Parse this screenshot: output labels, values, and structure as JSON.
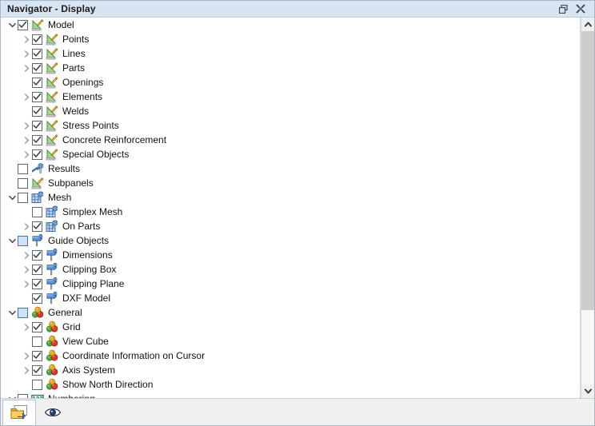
{
  "window": {
    "title": "Navigator - Display",
    "controls": [
      {
        "name": "restore-button",
        "icon": "restore-icon"
      },
      {
        "name": "close-button",
        "icon": "close-icon"
      }
    ]
  },
  "tree": {
    "rows": [
      {
        "label": "Model",
        "depth": 0,
        "twisty": "down",
        "check": "checked",
        "icon": "model-icon"
      },
      {
        "label": "Points",
        "depth": 1,
        "twisty": "right",
        "check": "checked",
        "icon": "model-icon"
      },
      {
        "label": "Lines",
        "depth": 1,
        "twisty": "right",
        "check": "checked",
        "icon": "model-icon"
      },
      {
        "label": "Parts",
        "depth": 1,
        "twisty": "right",
        "check": "checked",
        "icon": "model-icon"
      },
      {
        "label": "Openings",
        "depth": 1,
        "twisty": "none",
        "check": "checked",
        "icon": "model-icon"
      },
      {
        "label": "Elements",
        "depth": 1,
        "twisty": "right",
        "check": "checked",
        "icon": "model-icon"
      },
      {
        "label": "Welds",
        "depth": 1,
        "twisty": "none",
        "check": "checked",
        "icon": "model-icon"
      },
      {
        "label": "Stress Points",
        "depth": 1,
        "twisty": "right",
        "check": "checked",
        "icon": "model-icon"
      },
      {
        "label": "Concrete Reinforcement",
        "depth": 1,
        "twisty": "right",
        "check": "checked",
        "icon": "model-icon"
      },
      {
        "label": "Special Objects",
        "depth": 1,
        "twisty": "right",
        "check": "checked",
        "icon": "model-icon"
      },
      {
        "label": "Results",
        "depth": 0,
        "twisty": "none",
        "check": "unchecked",
        "icon": "results-icon"
      },
      {
        "label": "Subpanels",
        "depth": 0,
        "twisty": "none",
        "check": "unchecked",
        "icon": "model-icon"
      },
      {
        "label": "Mesh",
        "depth": 0,
        "twisty": "down",
        "check": "unchecked",
        "icon": "mesh-icon"
      },
      {
        "label": "Simplex Mesh",
        "depth": 1,
        "twisty": "none",
        "check": "unchecked",
        "icon": "mesh-icon"
      },
      {
        "label": "On Parts",
        "depth": 1,
        "twisty": "right",
        "check": "checked",
        "icon": "mesh-icon"
      },
      {
        "label": "Guide Objects",
        "depth": 0,
        "twisty": "down",
        "check": "partial",
        "icon": "guide-icon"
      },
      {
        "label": "Dimensions",
        "depth": 1,
        "twisty": "right",
        "check": "checked",
        "icon": "guide-icon"
      },
      {
        "label": "Clipping Box",
        "depth": 1,
        "twisty": "right",
        "check": "checked",
        "icon": "guide-icon"
      },
      {
        "label": "Clipping Plane",
        "depth": 1,
        "twisty": "right",
        "check": "checked",
        "icon": "guide-icon"
      },
      {
        "label": "DXF Model",
        "depth": 1,
        "twisty": "none",
        "check": "checked",
        "icon": "guide-icon"
      },
      {
        "label": "General",
        "depth": 0,
        "twisty": "down",
        "check": "partial",
        "icon": "general-icon"
      },
      {
        "label": "Grid",
        "depth": 1,
        "twisty": "right",
        "check": "checked",
        "icon": "general-icon"
      },
      {
        "label": "View Cube",
        "depth": 1,
        "twisty": "none",
        "check": "unchecked",
        "icon": "general-icon"
      },
      {
        "label": "Coordinate Information on Cursor",
        "depth": 1,
        "twisty": "right",
        "check": "checked",
        "icon": "general-icon"
      },
      {
        "label": "Axis System",
        "depth": 1,
        "twisty": "right",
        "check": "checked",
        "icon": "general-icon"
      },
      {
        "label": "Show North Direction",
        "depth": 1,
        "twisty": "none",
        "check": "unchecked",
        "icon": "general-icon"
      },
      {
        "label": "Numbering",
        "depth": 0,
        "twisty": "down",
        "check": "unchecked",
        "icon": "numbering-icon"
      }
    ]
  },
  "scrollbar": {
    "up_icon": "chevron-up-icon",
    "down_icon": "chevron-down-icon",
    "thumb_top_pct": 0,
    "thumb_height_pct": 79
  },
  "tabbar": {
    "tabs": [
      {
        "name": "tab-project-navigator",
        "icon": "folder-export-icon",
        "active": true
      },
      {
        "name": "tab-display-navigator",
        "icon": "eye-icon",
        "active": false
      }
    ]
  },
  "colors": {
    "titlebar_bg": "#d7e4f2",
    "partial_check_fill": "#cfe2f7",
    "partial_check_border": "#3a74c4",
    "scroll_thumb": "#cdcdcd",
    "text": "#111111"
  }
}
